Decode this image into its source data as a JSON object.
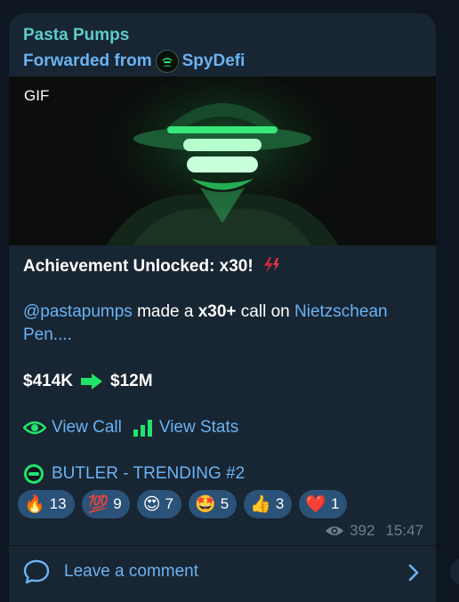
{
  "message": {
    "channel_name": "Pasta Pumps",
    "forwarded_prefix": "Forwarded from",
    "forwarded_source": "SpyDefi",
    "media_label": "GIF",
    "heading": "Achievement Unlocked: x30!",
    "mention": "@pastapumps",
    "made_a": " made a ",
    "multiplier": "x30+",
    "call_on": " call on ",
    "token_link": "Nietzschean",
    "token_link_cont": "Pen....",
    "price_from": "$414K",
    "price_to": "$12M",
    "view_call": "View Call",
    "view_stats": "View Stats",
    "trending": "BUTLER - TRENDING #2",
    "views": "392",
    "time": "15:47"
  },
  "reactions": [
    {
      "emoji": "🔥",
      "count": "13"
    },
    {
      "emoji": "💯",
      "count": "9"
    },
    {
      "emoji": "😍",
      "count": "7"
    },
    {
      "emoji": "🤩",
      "count": "5"
    },
    {
      "emoji": "👍",
      "count": "3"
    },
    {
      "emoji": "❤️",
      "count": "1"
    }
  ],
  "footer": {
    "comment_label": "Leave a comment"
  },
  "colors": {
    "background": "#0e1621",
    "bubble": "#182533",
    "link": "#6ab3f3",
    "channel": "#5ecbc8",
    "reaction_bg": "#2b5278",
    "accent_green": "#22e36a"
  }
}
